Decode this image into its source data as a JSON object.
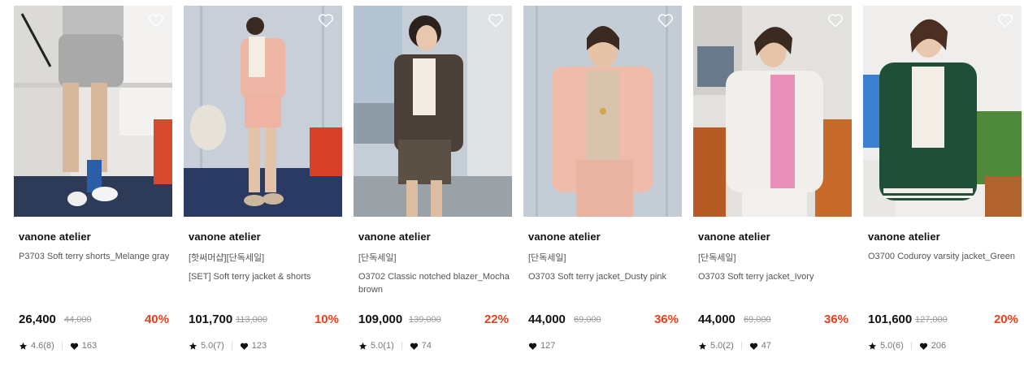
{
  "colors": {
    "discount": "#e8401c",
    "text": "#111111",
    "muted": "#777777"
  },
  "icons": {
    "wishlist": "heart-outline-icon",
    "rating": "star-icon",
    "likes": "heart-icon"
  },
  "products": [
    {
      "brand": "vanone atelier",
      "tag": "",
      "name": "P3703 Soft terry shorts_Melange gray",
      "price": "26,400",
      "original_price": "44,000",
      "discount": "40%",
      "rating": "4.6(8)",
      "likes": "163"
    },
    {
      "brand": "vanone atelier",
      "tag": "[핫써머샵][단독세일]",
      "name": "[SET] Soft terry jacket & shorts",
      "price": "101,700",
      "original_price": "113,000",
      "discount": "10%",
      "rating": "5.0(7)",
      "likes": "123"
    },
    {
      "brand": "vanone atelier",
      "tag": "[단독세일]",
      "name": "O3702 Classic notched blazer_Mocha brown",
      "price": "109,000",
      "original_price": "139,000",
      "discount": "22%",
      "rating": "5.0(1)",
      "likes": "74"
    },
    {
      "brand": "vanone atelier",
      "tag": "[단독세일]",
      "name": "O3703 Soft terry jacket_Dusty pink",
      "price": "44,000",
      "original_price": "69,000",
      "discount": "36%",
      "rating": "",
      "likes": "127"
    },
    {
      "brand": "vanone atelier",
      "tag": "[단독세일]",
      "name": "O3703 Soft terry jacket_Ivory",
      "price": "44,000",
      "original_price": "69,000",
      "discount": "36%",
      "rating": "5.0(2)",
      "likes": "47"
    },
    {
      "brand": "vanone atelier",
      "tag": "",
      "name": "O3700 Coduroy varsity jacket_Green",
      "price": "101,600",
      "original_price": "127,000",
      "discount": "20%",
      "rating": "5.0(6)",
      "likes": "206"
    }
  ]
}
